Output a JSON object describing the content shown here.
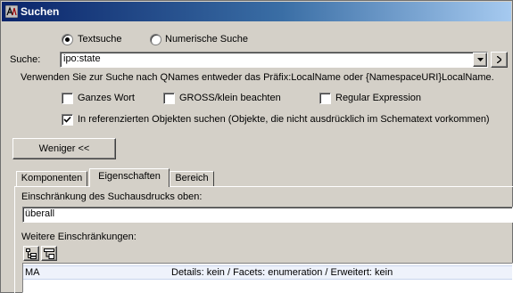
{
  "window": {
    "title": "Suchen"
  },
  "search_mode": {
    "options": [
      {
        "label": "Textsuche",
        "selected": true
      },
      {
        "label": "Numerische Suche",
        "selected": false
      }
    ]
  },
  "search": {
    "label": "Suche:",
    "value": "ipo:state"
  },
  "hint": "Verwenden Sie zur Suche nach QNames entweder das Präfix:LocalName oder {NamespaceURI}LocalName.",
  "options": {
    "whole_word": {
      "label": "Ganzes Wort",
      "checked": false
    },
    "match_case": {
      "label": "GROSS/klein beachten",
      "checked": false
    },
    "regex": {
      "label": "Regular Expression",
      "checked": false
    },
    "referenced": {
      "label": "In referenzierten Objekten suchen (Objekte, die nicht ausdrücklich im Schematext vorkommen)",
      "checked": true
    }
  },
  "less_button": "Weniger <<",
  "tabs": [
    {
      "label": "Komponenten",
      "active": false
    },
    {
      "label": "Eigenschaften",
      "active": true
    },
    {
      "label": "Bereich",
      "active": false
    }
  ],
  "restriction": {
    "label": "Einschränkung des Suchausdrucks oben:",
    "value": "überall"
  },
  "more_restrictions": {
    "label": "Weitere Einschränkungen:",
    "rows": [
      {
        "name": "MA",
        "details": "Details: kein / Facets: enumeration / Erweitert: kein"
      }
    ]
  },
  "colors": {
    "title_start": "#0a246a",
    "title_end": "#a6caf0",
    "face": "#d4d0c8",
    "selected_row": "#eef2fb"
  }
}
